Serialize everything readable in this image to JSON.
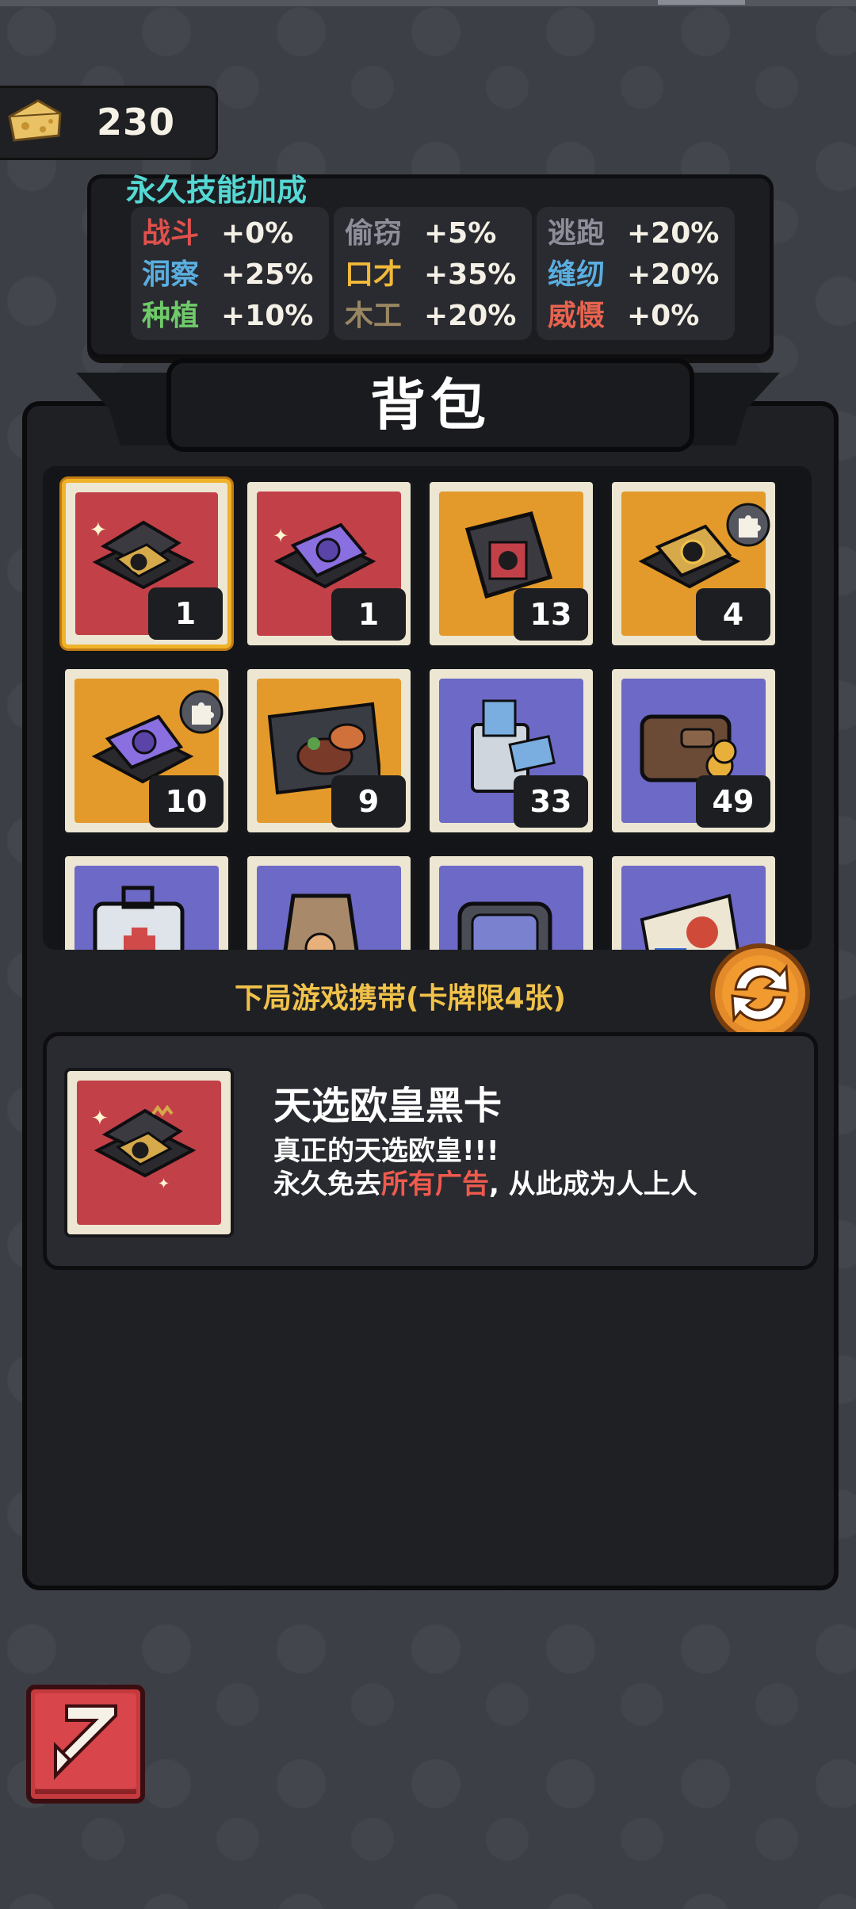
{
  "currency": {
    "value": "230",
    "icon": "cheese-icon"
  },
  "skills": {
    "title": "永久技能加成",
    "columns": [
      [
        {
          "name": "战斗",
          "value": "+0%",
          "color": "#e0514d"
        },
        {
          "name": "洞察",
          "value": "+25%",
          "color": "#5aaee0"
        },
        {
          "name": "种植",
          "value": "+10%",
          "color": "#6fcb6a"
        }
      ],
      [
        {
          "name": "偷窃",
          "value": "+5%",
          "color": "#8d8e99"
        },
        {
          "name": "口才",
          "value": "+35%",
          "color": "#f0b93a"
        },
        {
          "name": "木工",
          "value": "+20%",
          "color": "#9a8762"
        }
      ],
      [
        {
          "name": "逃跑",
          "value": "+20%",
          "color": "#8d8e99"
        },
        {
          "name": "缝纫",
          "value": "+20%",
          "color": "#5aaee0"
        },
        {
          "name": "威慑",
          "value": "+0%",
          "color": "#e8634e"
        }
      ]
    ]
  },
  "backpack": {
    "title": "背包",
    "items": [
      {
        "name": "black-card-box",
        "count": "1",
        "bg": "red",
        "selected": true
      },
      {
        "name": "purple-card-box",
        "count": "1",
        "bg": "red"
      },
      {
        "name": "card-pack",
        "count": "13",
        "bg": "orange"
      },
      {
        "name": "gold-card-box",
        "count": "4",
        "bg": "orange",
        "puzzle": true
      },
      {
        "name": "purple-card-fragment",
        "count": "10",
        "bg": "orange",
        "puzzle": true
      },
      {
        "name": "steak-card",
        "count": "9",
        "bg": "orange"
      },
      {
        "name": "money-bag",
        "count": "33",
        "bg": "purple"
      },
      {
        "name": "wallet",
        "count": "49",
        "bg": "purple"
      },
      {
        "name": "first-aid-kit",
        "count": "",
        "bg": "purple"
      },
      {
        "name": "paper-bag",
        "count": "",
        "bg": "purple"
      },
      {
        "name": "tv-device",
        "count": "",
        "bg": "purple"
      },
      {
        "name": "sticker-pack",
        "count": "",
        "bg": "purple"
      }
    ]
  },
  "carry_label": "下局游戏携带(卡牌限4张)",
  "selected_item": {
    "name": "天选欧皇黑卡",
    "desc_line1": "真正的天选欧皇!!!",
    "desc_line2_a": "永久免去",
    "desc_line2_hl": "所有广告",
    "desc_line2_b": ", 从此成为人上人"
  },
  "colors": {
    "highlight": "#ef5a4d",
    "gold": "#f0c24a",
    "skills_title": "#55d8d4",
    "selected_border": "#f0b229"
  }
}
